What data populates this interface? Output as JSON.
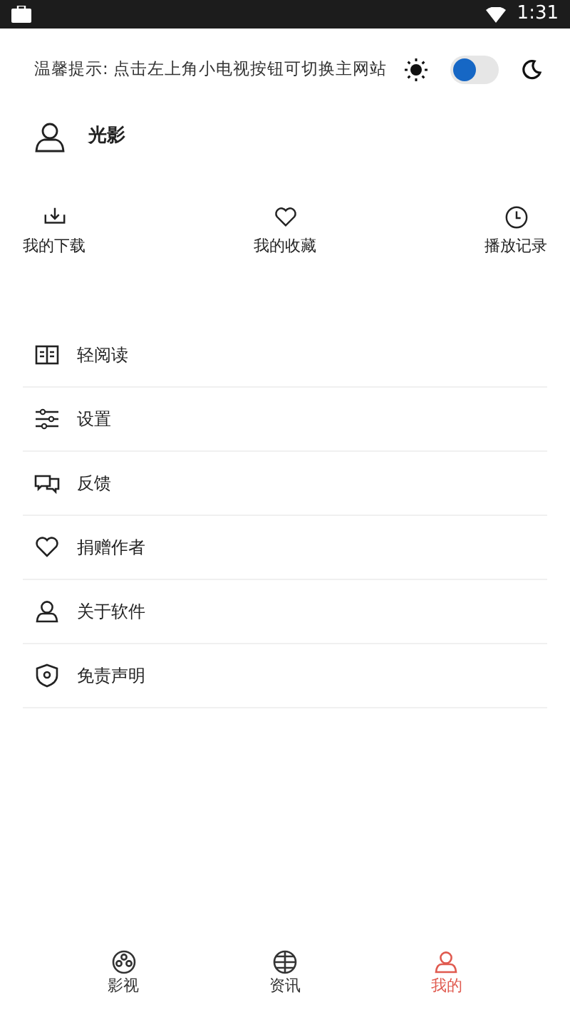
{
  "status_bar": {
    "time": "1:31"
  },
  "tip": {
    "text": "温馨提示: 点击左上角小电视按钮可切换主网站"
  },
  "dark_mode": {
    "on": false
  },
  "user": {
    "name": "光影"
  },
  "shortcuts": [
    {
      "kind": "download",
      "label": "我的下载"
    },
    {
      "kind": "heart",
      "label": "我的收藏"
    },
    {
      "kind": "clock",
      "label": "播放记录"
    }
  ],
  "menu": [
    {
      "kind": "book",
      "label": "轻阅读"
    },
    {
      "kind": "sliders",
      "label": "设置"
    },
    {
      "kind": "chat",
      "label": "反馈"
    },
    {
      "kind": "heart",
      "label": "捐赠作者"
    },
    {
      "kind": "person",
      "label": "关于软件"
    },
    {
      "kind": "shield",
      "label": "免责声明"
    }
  ],
  "tabs": [
    {
      "kind": "film",
      "label": "影视",
      "selected": false
    },
    {
      "kind": "globe",
      "label": "资讯",
      "selected": false
    },
    {
      "kind": "person",
      "label": "我的",
      "selected": true
    }
  ]
}
